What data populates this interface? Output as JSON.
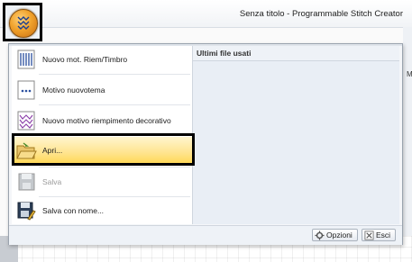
{
  "window": {
    "title": "Senza titolo - Programmable Stitch Creator"
  },
  "app_button": {
    "icon": "application-menu-icon"
  },
  "menu": {
    "items": [
      {
        "label": "Nuovo mot. Riem/Timbro",
        "icon": "new-fill-stamp-icon",
        "enabled": true
      },
      {
        "label": "Motivo nuovotema",
        "icon": "new-motif-icon",
        "enabled": true
      },
      {
        "label": "Nuovo motivo riempimento decorativo",
        "icon": "new-decorative-fill-icon",
        "enabled": true
      },
      {
        "label": "Apri...",
        "icon": "open-folder-icon",
        "enabled": true,
        "highlighted": true
      },
      {
        "label": "Salva",
        "icon": "save-icon",
        "enabled": false
      },
      {
        "label": "Salva con nome...",
        "icon": "save-as-icon",
        "enabled": true
      }
    ],
    "recent": {
      "heading": "Ultimi file usati"
    },
    "buttons": {
      "options_label": "Opzioni",
      "exit_label": "Esci"
    }
  },
  "background": {
    "side_label": "Mo"
  }
}
